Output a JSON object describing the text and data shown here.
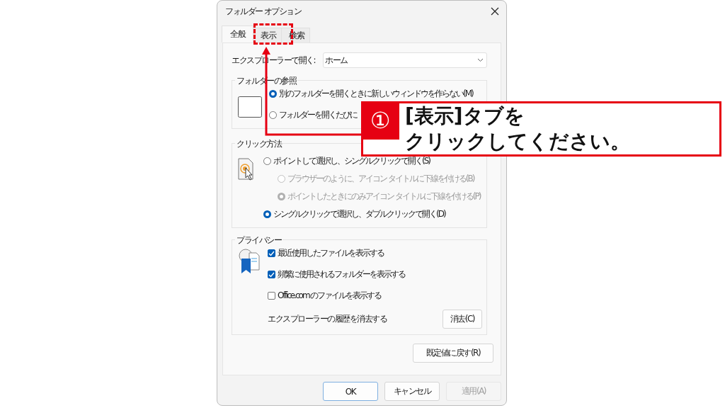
{
  "window": {
    "title": "フォルダー オプション"
  },
  "tabs": [
    {
      "label": "全般",
      "selected": true
    },
    {
      "label": "表示",
      "selected": false
    },
    {
      "label": "検索",
      "selected": false
    }
  ],
  "open_in": {
    "label": "エクスプローラーで開く:",
    "value": "ホーム"
  },
  "browse_folders": {
    "title": "フォルダーの参照",
    "options": [
      {
        "label": "別のフォルダーを開くときに新しいウィンドウを作らない(M)",
        "selected": true,
        "disabled": false
      },
      {
        "label": "フォルダーを開くたびに",
        "selected": false,
        "disabled": false
      }
    ]
  },
  "click_method": {
    "title": "クリック方法",
    "options": [
      {
        "label": "ポイントして選択し、シングルクリックで開く(S)",
        "selected": false,
        "disabled": false,
        "children": [
          {
            "label": "ブラウザーのように、アイコン タイトルに下線を付ける(B)",
            "selected": false,
            "disabled": true
          },
          {
            "label": "ポイントしたときにのみアイコン タイトルに下線を付ける(P)",
            "selected": true,
            "disabled": true
          }
        ]
      },
      {
        "label": "シングルクリックで選択し、ダブルクリックで開く(D)",
        "selected": true,
        "disabled": false
      }
    ]
  },
  "privacy": {
    "title": "プライバシー",
    "checks": [
      {
        "label": "最近使用したファイルを表示する",
        "checked": true
      },
      {
        "label": "頻繁に使用されるフォルダーを表示する",
        "checked": true
      },
      {
        "label": "Office.com のファイルを表示する",
        "checked": false
      }
    ],
    "clear_label": "エクスプローラーの履歴を消去する",
    "clear_button": "消去(C)"
  },
  "restore_button": "既定値に戻す(R)",
  "buttons": [
    {
      "label": "OK",
      "kind": "default",
      "disabled": false
    },
    {
      "label": "キャンセル",
      "kind": "normal",
      "disabled": false
    },
    {
      "label": "適用(A)",
      "kind": "normal",
      "disabled": true
    }
  ],
  "callout": {
    "number": "①",
    "lines": [
      "[表示]タブを",
      "クリックしてください。"
    ]
  }
}
